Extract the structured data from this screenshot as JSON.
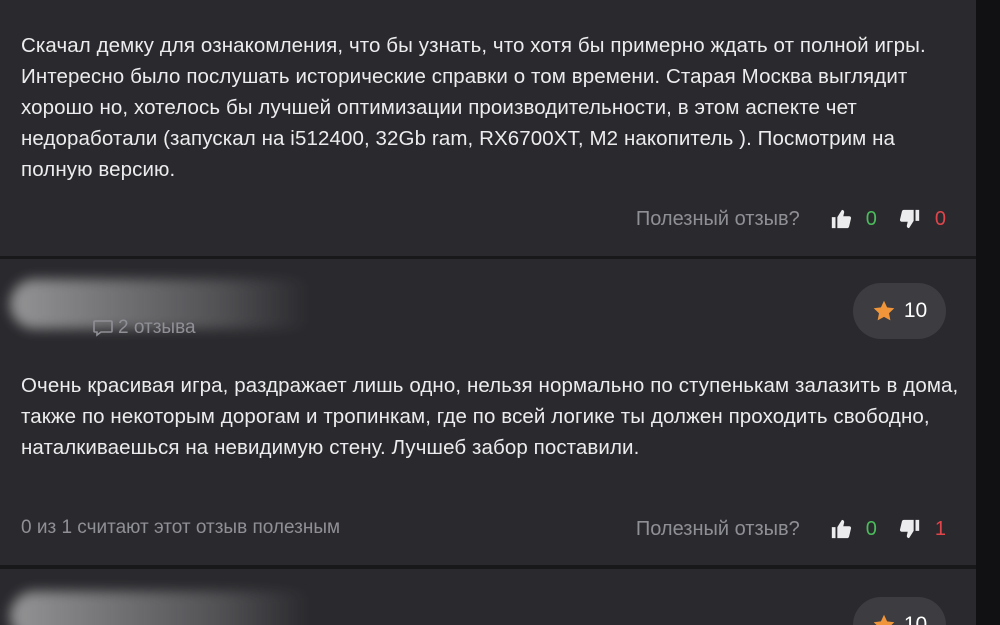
{
  "reviews": [
    {
      "text": "Скачал демку для ознакомления, что бы узнать, что хотя бы примерно ждать от полной игры. Интересно было послушать исторические справки о том времени. Старая Москва выглядит хорошо но, хотелось бы лучшей оптимизации производительности, в этом аспекте чет недоработали (запускал на i512400, 32Gb ram, RX6700XT, M2 накопитель ). Посмотрим на полную версию.",
      "helpful_question": "Полезный отзыв?",
      "likes": "0",
      "dislikes": "0"
    },
    {
      "reviews_count": "2 отзыва",
      "score": "10",
      "text": "Очень красивая игра, раздражает лишь одно, нельзя нормально по ступенькам залазить в дома, также по некоторым дорогам и тропинкам, где по всей логике ты должен проходить свободно, наталкиваешься на невидимую стену. Лучшеб забор поставили.",
      "helpful_counter": "0 из 1 считают этот отзыв полезным",
      "helpful_question": "Полезный отзыв?",
      "likes": "0",
      "dislikes": "1"
    },
    {
      "score": "10"
    }
  ],
  "icons": {
    "like": "thumbs-up-icon",
    "dislike": "thumbs-down-icon",
    "star": "star-icon",
    "comment": "comment-icon"
  },
  "colors": {
    "likes": "#4cba5c",
    "dislikes": "#e0454b",
    "star": "#f0953a",
    "card": "#2a2a2e"
  }
}
